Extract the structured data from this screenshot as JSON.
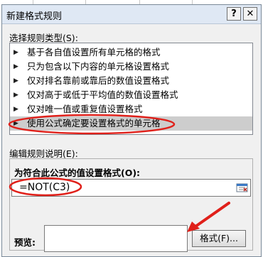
{
  "window": {
    "title": "新建格式规则",
    "help_label": "?",
    "close_label": "✕"
  },
  "rule_type": {
    "label": "选择规则类型(S):",
    "items": [
      {
        "label": "基于各自值设置所有单元格的格式"
      },
      {
        "label": "只为包含以下内容的单元格设置格式"
      },
      {
        "label": "仅对排名靠前或靠后的数值设置格式"
      },
      {
        "label": "仅对高于或低于平均值的数值设置格式"
      },
      {
        "label": "仅对唯一值或重复值设置格式"
      },
      {
        "label": "使用公式确定要设置格式的单元格"
      }
    ],
    "selected_index": 5
  },
  "edit": {
    "label": "编辑规则说明(E):",
    "formula_label": "为符合此公式的值设置格式(O):",
    "formula_value": "=NOT(C3)",
    "preview_label": "预览:",
    "format_button": "格式(F)..."
  },
  "colors": {
    "annotation": "#e0201a",
    "selected_row": "#cdcdcd"
  }
}
